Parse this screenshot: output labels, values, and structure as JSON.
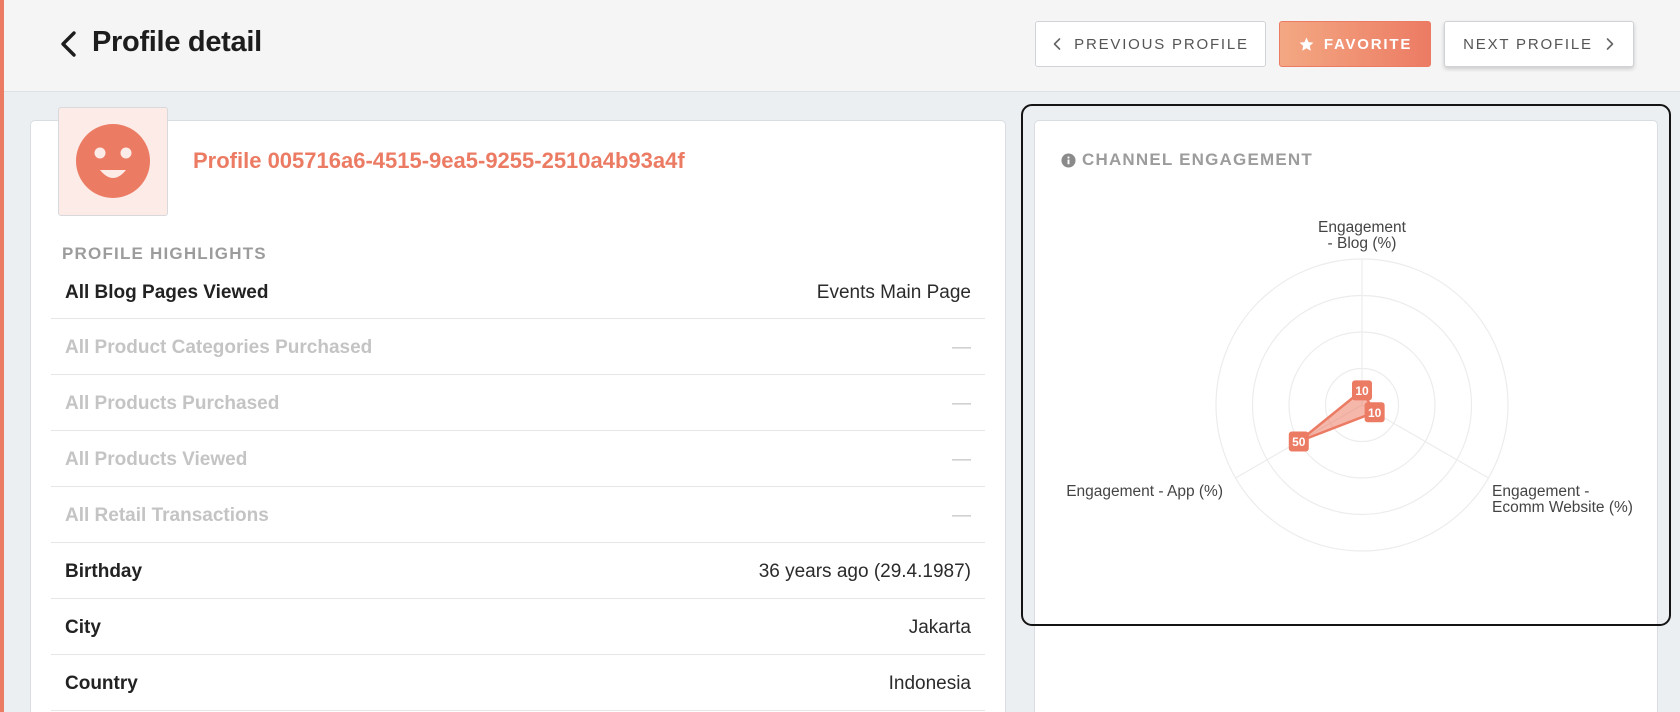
{
  "header": {
    "title": "Profile detail",
    "prev_label": "PREVIOUS PROFILE",
    "favorite_label": "FAVORITE",
    "next_label": "NEXT PROFILE"
  },
  "profile": {
    "id_text": "Profile 005716a6-4515-9ea5-9255-2510a4b93a4f",
    "highlights_label": "PROFILE HIGHLIGHTS",
    "rows": [
      {
        "label": "All Blog Pages Viewed",
        "value": "Events Main Page",
        "empty": false
      },
      {
        "label": "All Product Categories Purchased",
        "value": "—",
        "empty": true
      },
      {
        "label": "All Products Purchased",
        "value": "—",
        "empty": true
      },
      {
        "label": "All Products Viewed",
        "value": "—",
        "empty": true
      },
      {
        "label": "All Retail Transactions",
        "value": "—",
        "empty": true
      },
      {
        "label": "Birthday",
        "value": "36 years ago (29.4.1987)",
        "empty": false
      },
      {
        "label": "City",
        "value": "Jakarta",
        "empty": false
      },
      {
        "label": "Country",
        "value": "Indonesia",
        "empty": false
      }
    ]
  },
  "engagement": {
    "title": "CHANNEL ENGAGEMENT",
    "axes": [
      {
        "label_lines": [
          "Engagement",
          "- Blog (%)"
        ],
        "value": 10
      },
      {
        "label_lines": [
          "Engagement -",
          "Ecomm Website (%)"
        ],
        "value": 10
      },
      {
        "label_lines": [
          "Engagement - App (%)"
        ],
        "value": 50
      }
    ],
    "max": 100,
    "ring_count": 4
  },
  "colors": {
    "accent": "#ec7b64",
    "accent_light": "#f3a882",
    "avatar_bg": "#fcebe6"
  },
  "icons": {
    "back": "chevron-left-icon",
    "prev": "chevron-left-icon",
    "favorite": "star-icon",
    "next": "chevron-right-icon",
    "info": "info-icon",
    "avatar": "smiley-face-icon"
  }
}
